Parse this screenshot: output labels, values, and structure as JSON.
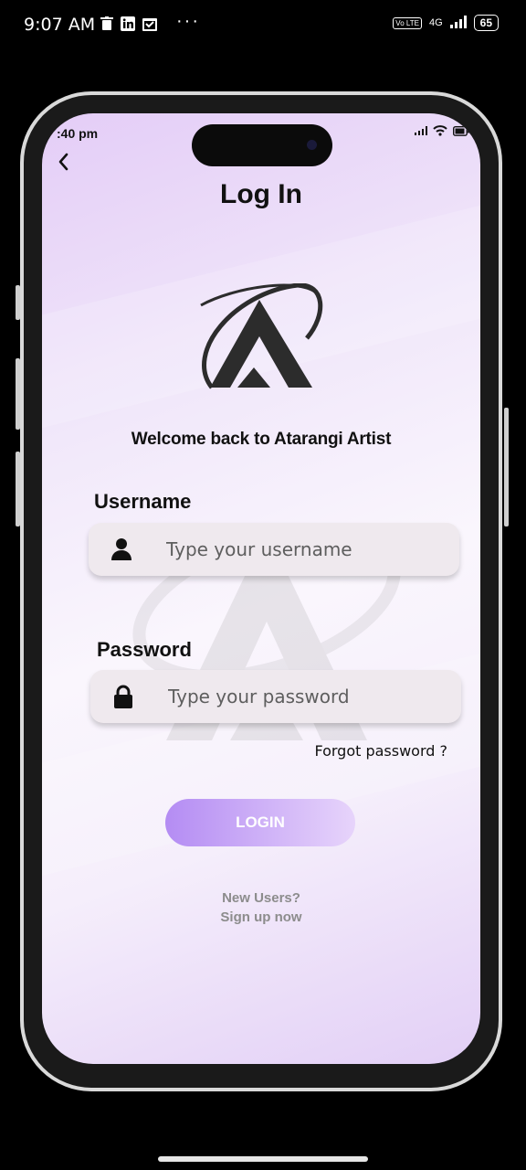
{
  "system": {
    "time": "9:07 AM",
    "network": "4G",
    "volte": "Vo LTE",
    "battery": "65"
  },
  "inner_status": {
    "time": ":40 pm"
  },
  "login": {
    "title": "Log In",
    "welcome": "Welcome back to  Atarangi  Artist",
    "username_label": "Username",
    "username_placeholder": "Type your username",
    "password_label": "Password",
    "password_placeholder": "Type your password",
    "forgot": "Forgot password ?",
    "button": "LOGIN",
    "new_users": "New Users?",
    "signup": "Sign up now"
  },
  "icons": {
    "back": "chevron-left-icon",
    "user": "user-icon",
    "lock": "lock-icon"
  },
  "colors": {
    "accent": "#b48cf3",
    "background": "#f1e8fa"
  }
}
